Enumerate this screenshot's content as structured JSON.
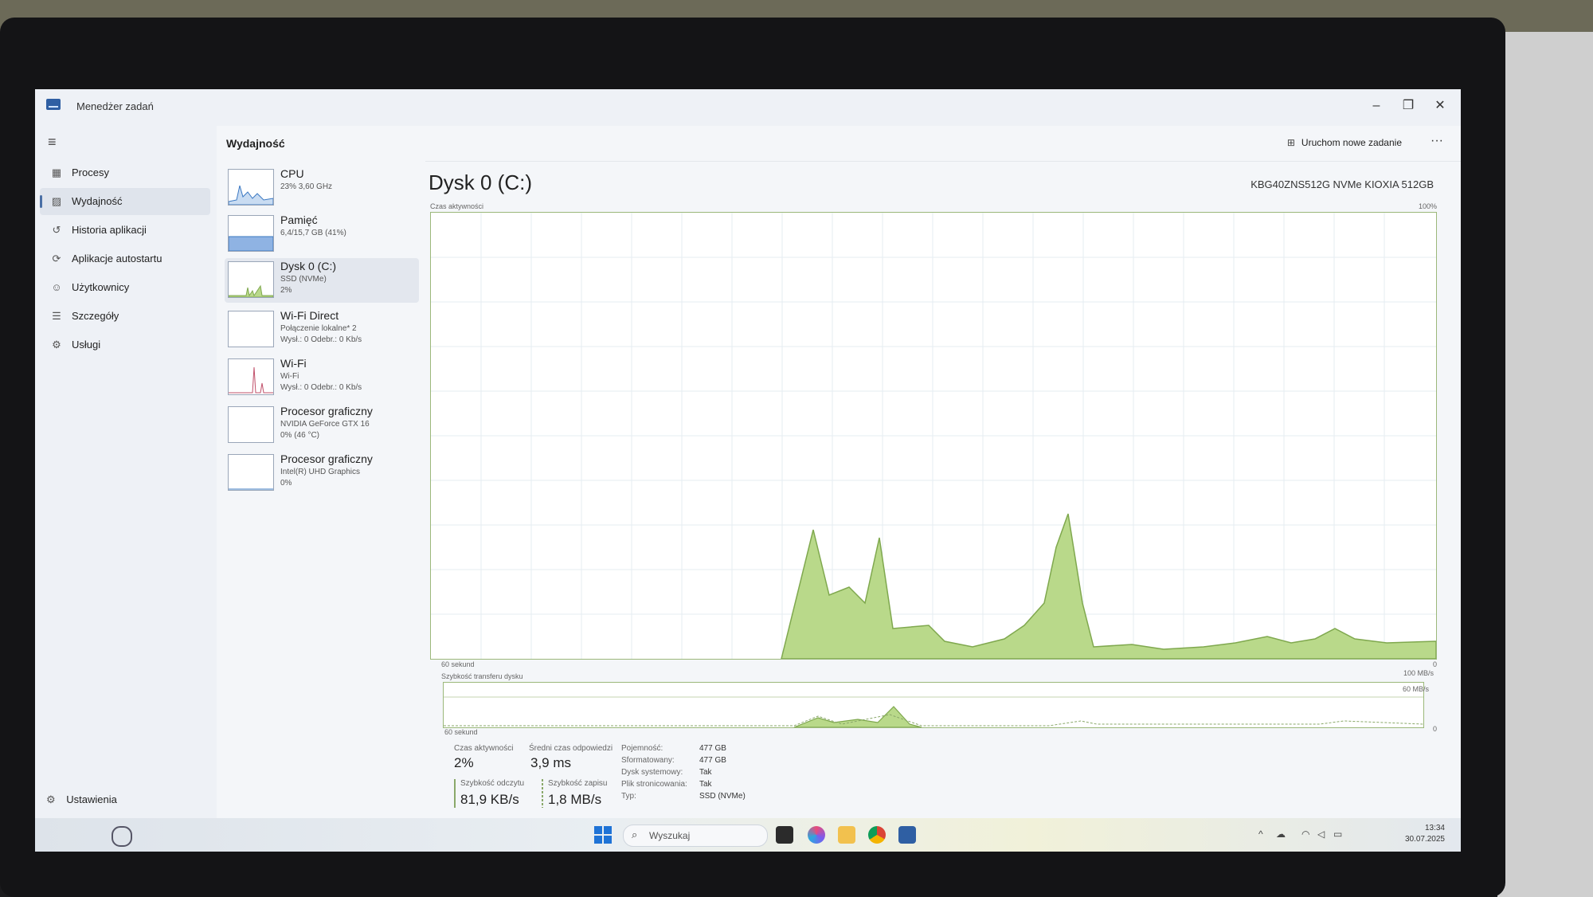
{
  "window": {
    "title": "Menedżer zadań"
  },
  "sidebar": {
    "items": [
      {
        "label": "Procesy",
        "icon": "processes-icon"
      },
      {
        "label": "Wydajność",
        "icon": "performance-icon"
      },
      {
        "label": "Historia aplikacji",
        "icon": "history-icon"
      },
      {
        "label": "Aplikacje autostartu",
        "icon": "startup-icon"
      },
      {
        "label": "Użytkownicy",
        "icon": "users-icon"
      },
      {
        "label": "Szczegóły",
        "icon": "details-icon"
      },
      {
        "label": "Usługi",
        "icon": "services-icon"
      }
    ],
    "settings_label": "Ustawienia"
  },
  "header": {
    "title": "Wydajność",
    "new_task_label": "Uruchom nowe zadanie"
  },
  "resources": [
    {
      "name": "CPU",
      "line1": "23% 3,60 GHz",
      "line2": ""
    },
    {
      "name": "Pamięć",
      "line1": "6,4/15,7 GB (41%)",
      "line2": ""
    },
    {
      "name": "Dysk 0 (C:)",
      "line1": "SSD (NVMe)",
      "line2": "2%"
    },
    {
      "name": "Wi-Fi Direct",
      "line1": "Połączenie lokalne* 2",
      "line2": "Wysł.: 0 Odebr.: 0 Kb/s"
    },
    {
      "name": "Wi-Fi",
      "line1": "Wi-Fi",
      "line2": "Wysł.: 0 Odebr.: 0 Kb/s"
    },
    {
      "name": "Procesor graficzny",
      "line1": "NVIDIA GeForce GTX 16",
      "line2": "0% (46 °C)"
    },
    {
      "name": "Procesor graficzny",
      "line1": "Intel(R) UHD Graphics",
      "line2": "0%"
    }
  ],
  "detail": {
    "title": "Dysk 0 (C:)",
    "model": "KBG40ZNS512G NVMe KIOXIA 512GB",
    "active_chart": {
      "label": "Czas aktywności",
      "max_label": "100%",
      "time_label": "60 sekund",
      "zero_label": "0"
    },
    "transfer_chart": {
      "label": "Szybkość transferu dysku",
      "max_label": "100 MB/s",
      "mid_label": "60 MB/s",
      "time_label": "60 sekund",
      "zero_label": "0"
    },
    "stats": {
      "active_time_label": "Czas aktywności",
      "active_time_value": "2%",
      "response_label": "Średni czas odpowiedzi",
      "response_value": "3,9 ms",
      "read_label": "Szybkość odczytu",
      "read_value": "81,9 KB/s",
      "write_label": "Szybkość zapisu",
      "write_value": "1,8 MB/s"
    },
    "properties": [
      {
        "key": "Pojemność:",
        "value": "477 GB"
      },
      {
        "key": "Sformatowany:",
        "value": "477 GB"
      },
      {
        "key": "Dysk systemowy:",
        "value": "Tak"
      },
      {
        "key": "Plik stronicowania:",
        "value": "Tak"
      },
      {
        "key": "Typ:",
        "value": "SSD (NVMe)"
      }
    ]
  },
  "taskbar": {
    "search_placeholder": "Wyszukaj",
    "time": "13:34",
    "date": "30.07.2025"
  },
  "colors": {
    "accent": "#4a6fa5",
    "disk_fill": "#b9d98a",
    "disk_line": "#7fa84e"
  }
}
